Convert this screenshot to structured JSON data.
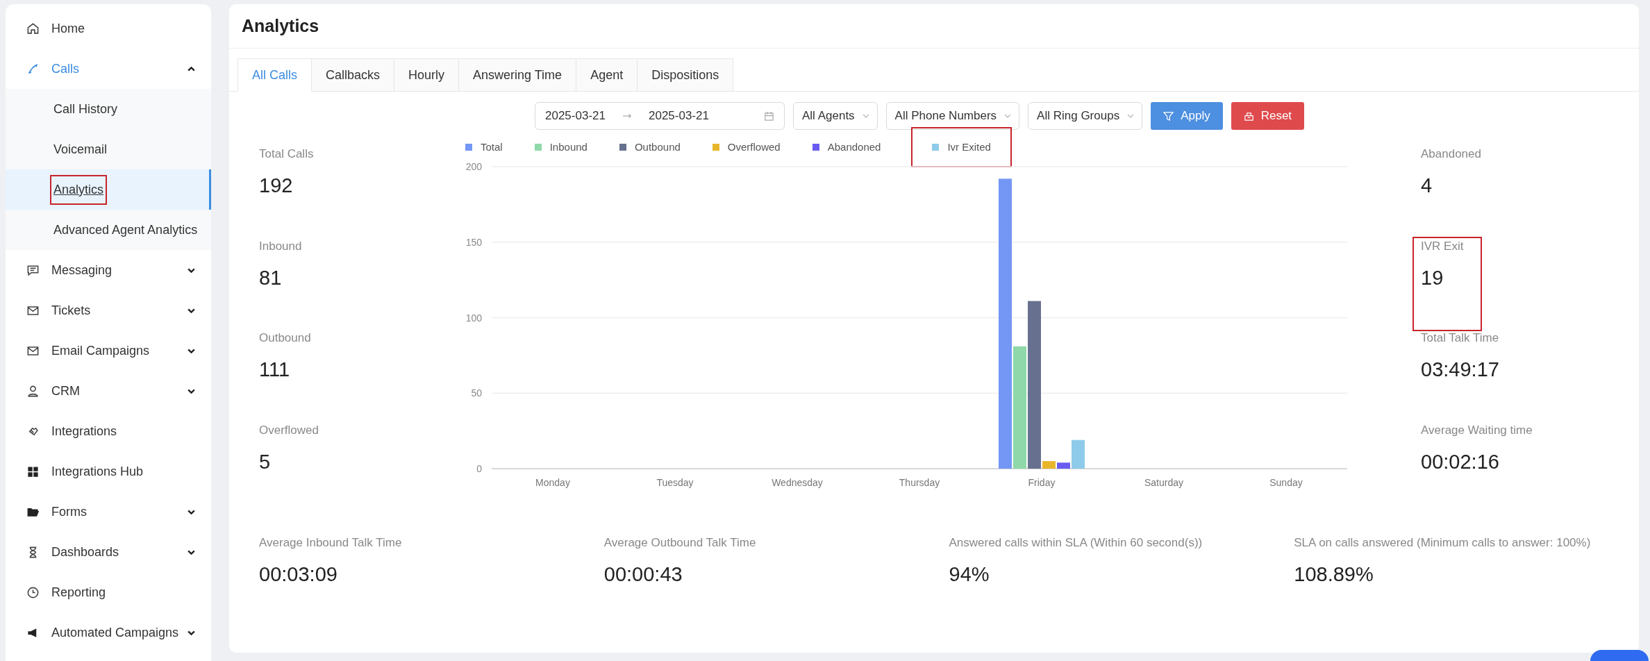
{
  "sidebar": {
    "items": [
      {
        "label": "Home",
        "selected": false
      },
      {
        "label": "Calls",
        "selected": true,
        "expanded": true,
        "children": [
          {
            "label": "Call History",
            "selected": false,
            "highlighted": false
          },
          {
            "label": "Voicemail",
            "selected": false,
            "highlighted": false
          },
          {
            "label": "Analytics",
            "selected": true,
            "highlighted": true
          },
          {
            "label": "Advanced Agent Analytics",
            "selected": false,
            "highlighted": false
          }
        ]
      },
      {
        "label": "Messaging",
        "selected": false,
        "expanded": false
      },
      {
        "label": "Tickets",
        "selected": false,
        "expanded": false
      },
      {
        "label": "Email Campaigns",
        "selected": false,
        "expanded": false
      },
      {
        "label": "CRM",
        "selected": false,
        "expanded": false
      },
      {
        "label": "Integrations",
        "selected": false
      },
      {
        "label": "Integrations Hub",
        "selected": false
      },
      {
        "label": "Forms",
        "selected": false,
        "expanded": false
      },
      {
        "label": "Dashboards",
        "selected": false,
        "expanded": false
      },
      {
        "label": "Reporting",
        "selected": false
      },
      {
        "label": "Automated Campaigns",
        "selected": false,
        "expanded": false
      }
    ]
  },
  "page": {
    "title": "Analytics"
  },
  "tabs": [
    {
      "label": "All Calls",
      "selected": true
    },
    {
      "label": "Callbacks",
      "selected": false
    },
    {
      "label": "Hourly",
      "selected": false
    },
    {
      "label": "Answering Time",
      "selected": false
    },
    {
      "label": "Agent",
      "selected": false
    },
    {
      "label": "Dispositions",
      "selected": false
    }
  ],
  "filters": {
    "date_from": "2025-03-21",
    "date_to": "2025-03-21",
    "agents": "All Agents",
    "phone_numbers": "All Phone Numbers",
    "ring_groups": "All Ring Groups",
    "apply": "Apply",
    "reset": "Reset"
  },
  "left_stats": [
    {
      "label": "Total Calls",
      "value": "192"
    },
    {
      "label": "Inbound",
      "value": "81"
    },
    {
      "label": "Outbound",
      "value": "111"
    },
    {
      "label": "Overflowed",
      "value": "5"
    }
  ],
  "chart": {
    "legend_items": [
      {
        "highlighted": false
      },
      {
        "highlighted": false
      },
      {
        "highlighted": false
      },
      {
        "highlighted": false
      },
      {
        "highlighted": false
      },
      {
        "highlighted": true
      }
    ],
    "chart_data": {
      "type": "bar",
      "grid": true,
      "legend": true,
      "categories": [
        "Monday",
        "Tuesday",
        "Wednesday",
        "Thursday",
        "Friday",
        "Saturday",
        "Sunday"
      ],
      "series": [
        {
          "name": "Total",
          "color": "#7496f4",
          "values": [
            0,
            0,
            0,
            0,
            192,
            0,
            0
          ]
        },
        {
          "name": "Inbound",
          "color": "#8fd8a9",
          "values": [
            0,
            0,
            0,
            0,
            81,
            0,
            0
          ]
        },
        {
          "name": "Outbound",
          "color": "#67718f",
          "values": [
            0,
            0,
            0,
            0,
            111,
            0,
            0
          ]
        },
        {
          "name": "Overflowed",
          "color": "#e9b62b",
          "values": [
            0,
            0,
            0,
            0,
            5,
            0,
            0
          ]
        },
        {
          "name": "Abandoned",
          "color": "#6a5cf1",
          "values": [
            0,
            0,
            0,
            0,
            4,
            0,
            0
          ]
        },
        {
          "name": "Ivr Exited",
          "color": "#8ecbea",
          "values": [
            0,
            0,
            0,
            0,
            19,
            0,
            0
          ]
        }
      ],
      "ylim": [
        0,
        200
      ],
      "yticks": [
        0,
        50,
        100,
        150,
        200
      ]
    }
  },
  "right_stats": [
    {
      "label": "Abandoned",
      "value": "4",
      "highlighted": false
    },
    {
      "label": "IVR Exit",
      "value": "19",
      "highlighted": true
    },
    {
      "label": "Total Talk Time",
      "value": "03:49:17",
      "highlighted": false
    },
    {
      "label": "Average Waiting time",
      "value": "00:02:16",
      "highlighted": false
    }
  ],
  "bottom_stats": [
    {
      "label": "Average Inbound Talk Time",
      "value": "00:03:09"
    },
    {
      "label": "Average Outbound Talk Time",
      "value": "00:00:43"
    },
    {
      "label": "Answered calls within SLA (Within 60 second(s))",
      "value": "94%"
    },
    {
      "label": "SLA on calls answered (Minimum calls to answer: 100%)",
      "value": "108.89%"
    }
  ]
}
